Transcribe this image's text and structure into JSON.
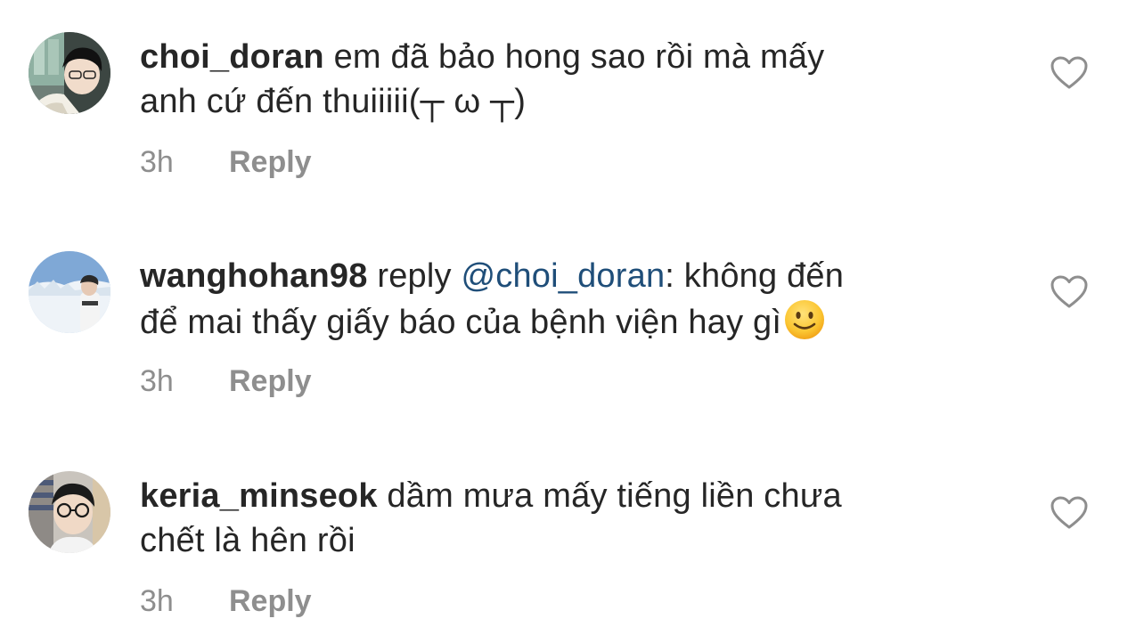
{
  "comments": [
    {
      "username": "choi_doran",
      "reply_label": "",
      "mention": "",
      "text": "em đã bảo hong sao rồi mà mấy anh cứ đến thuiiiii(┬ ω ┬)",
      "line1": " em đã bảo hong sao rồi mà mấy",
      "line2": "anh cứ đến thuiiiii(┬ ω ┬)",
      "time": "3h",
      "reply_button": "Reply",
      "avatar_icon": "avatar-photo",
      "like_icon": "heart-outline-icon"
    },
    {
      "username": "wanghohan98",
      "reply_label": " reply ",
      "mention": "@choi_doran",
      "line1_after": ": không đến",
      "line2": "để mai thấy giấy báo của bệnh viện hay gì",
      "emoji": "slightly-smiling-face-emoji",
      "time": "3h",
      "reply_button": "Reply",
      "avatar_icon": "avatar-photo",
      "like_icon": "heart-outline-icon"
    },
    {
      "username": "keria_minseok",
      "line1": " dầm mưa mấy tiếng liền chưa",
      "line2": "chết là hên rồi",
      "time": "3h",
      "reply_button": "Reply",
      "avatar_icon": "avatar-photo",
      "like_icon": "heart-outline-icon"
    }
  ],
  "colors": {
    "text": "#262626",
    "meta": "#8e8e8e",
    "mention": "#1f4e79",
    "icon": "#8e8e8e"
  }
}
